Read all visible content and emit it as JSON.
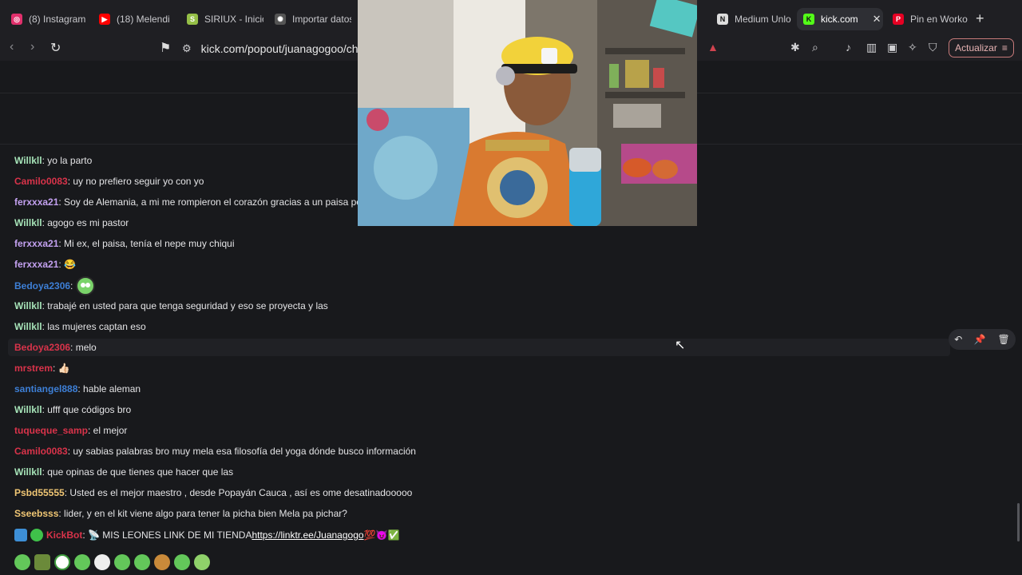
{
  "tabs": [
    {
      "label": "(8) Instagram",
      "icon": "instagram-icon",
      "color": "#e1306c"
    },
    {
      "label": "(18) Melendi",
      "icon": "youtube-icon",
      "color": "#ff0000"
    },
    {
      "label": "SIRIUX - Inicio",
      "icon": "shopify-icon",
      "color": "#95bf47"
    },
    {
      "label": "Importar datos",
      "icon": "chatgpt-icon",
      "color": "#9a9a9a"
    },
    {
      "label": "Medium Unlo",
      "icon": "notion-icon",
      "color": "#dddddd"
    },
    {
      "label": "kick.com",
      "icon": "kick-icon",
      "color": "#53fc18"
    },
    {
      "label": "Pin en Worko",
      "icon": "pinterest-icon",
      "color": "#e60023"
    }
  ],
  "toolbar": {
    "url": "kick.com/popout/juanagogoo/chat",
    "update_label": "Actualizar"
  },
  "messages": [
    {
      "user": "Willkll",
      "color": "#a6e3b8",
      "text": ": yo la parto"
    },
    {
      "user": "Camilo0083",
      "color": "#d9334a",
      "text": ": uy no prefiero seguir yo con yo"
    },
    {
      "user": "ferxxxa21",
      "color": "#c3a1f0",
      "text": ": Soy de Alemania, a mi me rompieron el corazón gracias a un paisa pe"
    },
    {
      "user": "Willkll",
      "color": "#a6e3b8",
      "text": ": agogo es mi pastor"
    },
    {
      "user": "ferxxxa21",
      "color": "#c3a1f0",
      "text": ": Mi ex, el paisa, tenía el nepe muy chiqui"
    },
    {
      "user": "ferxxxa21",
      "color": "#c3a1f0",
      "text": ": 😂"
    },
    {
      "user": "Bedoya2306",
      "color": "#3d7fd6",
      "text": ":"
    },
    {
      "user": "Willkll",
      "color": "#a6e3b8",
      "text": ": trabajé en usted para que tenga seguridad y eso se proyecta y las"
    },
    {
      "user": "Willkll",
      "color": "#a6e3b8",
      "text": ": las mujeres captan eso"
    },
    {
      "user": "Bedoya2306",
      "color": "#d9334a",
      "text": ": melo"
    },
    {
      "user": "mrstrem",
      "color": "#d9334a",
      "text": ": 👍🏻"
    },
    {
      "user": "santiangel888",
      "color": "#3d7fd6",
      "text": ": hable aleman"
    },
    {
      "user": "Willkll",
      "color": "#a6e3b8",
      "text": ": ufff que códigos bro"
    },
    {
      "user": "tuqueque_samp",
      "color": "#d9334a",
      "text": ": el mejor"
    },
    {
      "user": "Camilo0083",
      "color": "#d9334a",
      "text": ": uy sabias palabras bro muy mela esa filosofía del yoga dónde busco información"
    },
    {
      "user": "Willkll",
      "color": "#a6e3b8",
      "text": ": que opinas de que tienes que hacer que las"
    },
    {
      "user": "Psbd55555",
      "color": "#f0c674",
      "text": ": Usted es el mejor maestro , desde Popayán Cauca , así es ome desatinadooooo"
    },
    {
      "user": "Sseebsss",
      "color": "#f0c674",
      "text": ": lider, y en el kit viene algo para tener la picha bien Mela pa pichar?"
    }
  ],
  "bot_message": {
    "user": "KickBot",
    "color": "#d9334a",
    "text": ": 📡 MIS LEONES LINK DE MI TIENDA ",
    "link": "https://linktr.ee/Juanagogo",
    "suffix": " 💯😈✅"
  }
}
